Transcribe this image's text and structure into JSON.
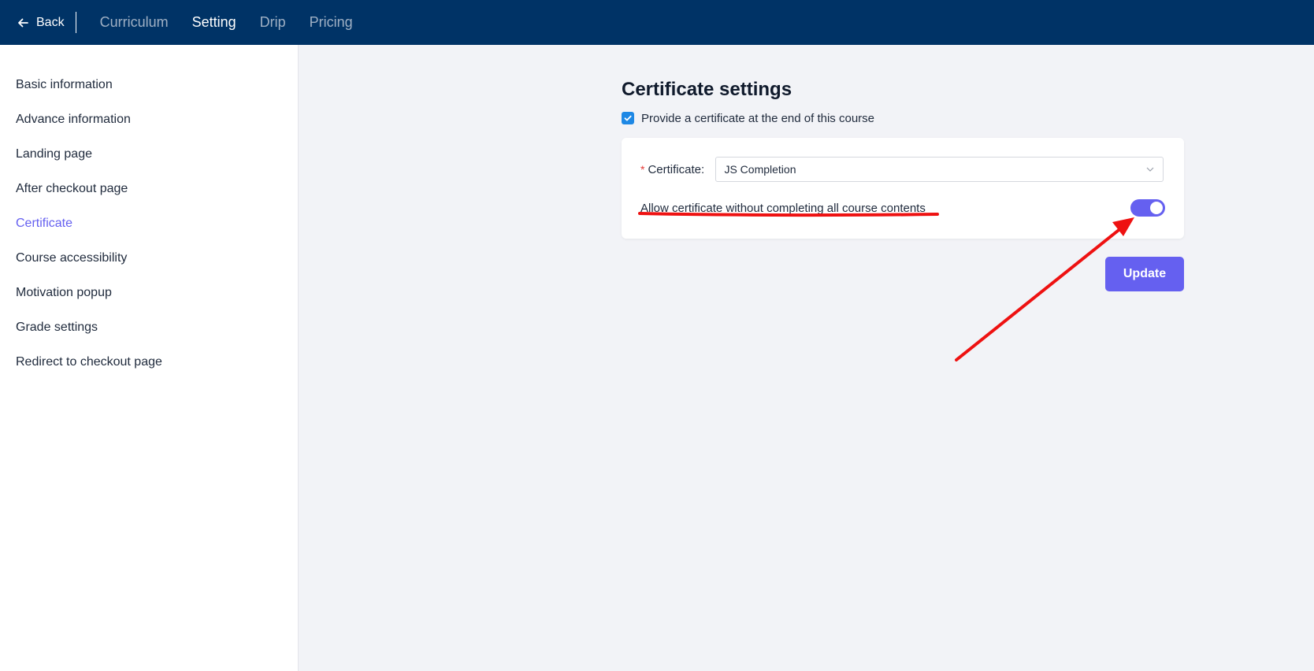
{
  "topbar": {
    "back_label": "Back",
    "tabs": [
      {
        "label": "Curriculum",
        "active": false
      },
      {
        "label": "Setting",
        "active": true
      },
      {
        "label": "Drip",
        "active": false
      },
      {
        "label": "Pricing",
        "active": false
      }
    ]
  },
  "sidebar": {
    "items": [
      {
        "label": "Basic information",
        "active": false
      },
      {
        "label": "Advance information",
        "active": false
      },
      {
        "label": "Landing page",
        "active": false
      },
      {
        "label": "After checkout page",
        "active": false
      },
      {
        "label": "Certificate",
        "active": true
      },
      {
        "label": "Course accessibility",
        "active": false
      },
      {
        "label": "Motivation popup",
        "active": false
      },
      {
        "label": "Grade settings",
        "active": false
      },
      {
        "label": "Redirect to checkout page",
        "active": false
      }
    ]
  },
  "main": {
    "title": "Certificate settings",
    "provide_checkbox": {
      "label": "Provide a certificate at the end of this course",
      "checked": true
    },
    "certificate_field": {
      "required_mark": "*",
      "label": "Certificate:",
      "value": "JS Completion"
    },
    "allow_toggle": {
      "label": "Allow certificate without completing all course contents",
      "on": true
    },
    "update_label": "Update"
  },
  "colors": {
    "topbar": "#003366",
    "accent": "#6560f0",
    "checkbox": "#1e88e5",
    "annotation": "#ee1111"
  }
}
